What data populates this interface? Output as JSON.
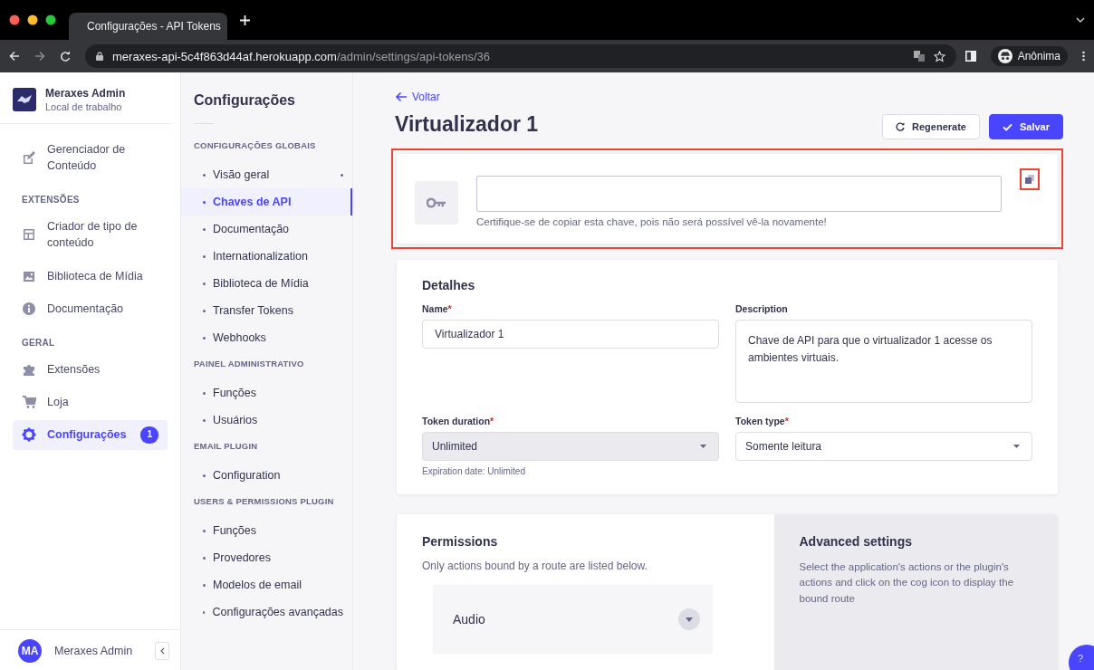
{
  "browser": {
    "tab_title": "Configurações - API Tokens",
    "url_host": "meraxes-api-5c4f863d44af.herokuapp.com",
    "url_path": "/admin/settings/api-tokens/36",
    "profile": "Anônima"
  },
  "sidebar": {
    "brand": {
      "title": "Meraxes Admin",
      "subtitle": "Local de trabalho"
    },
    "sections": [
      {
        "items": [
          {
            "label": "Gerenciador de Conteúdo",
            "selected": false
          }
        ]
      },
      {
        "heading": "EXTENSÕES",
        "items": [
          {
            "label": "Criador de tipo de conteúdo",
            "selected": false
          },
          {
            "label": "Biblioteca de Mídia",
            "selected": false
          },
          {
            "label": "Documentação",
            "selected": false
          }
        ]
      },
      {
        "heading": "GERAL",
        "items": [
          {
            "label": "Extensões",
            "selected": false
          },
          {
            "label": "Loja",
            "selected": false
          },
          {
            "label": "Configurações",
            "selected": true,
            "badge": "1"
          }
        ]
      }
    ],
    "user": {
      "initials": "MA",
      "name": "Meraxes Admin"
    }
  },
  "settings_nav": {
    "title": "Configurações",
    "sections": [
      {
        "heading": "CONFIGURAÇÕES GLOBAIS",
        "items": [
          {
            "label": "Visão geral",
            "selected": false,
            "marked": true
          },
          {
            "label": "Chaves de API",
            "selected": true,
            "marked": false
          },
          {
            "label": "Documentação",
            "selected": false,
            "marked": false
          },
          {
            "label": "Internationalization",
            "selected": false,
            "marked": false
          },
          {
            "label": "Biblioteca de Mídia",
            "selected": false,
            "marked": false
          },
          {
            "label": "Transfer Tokens",
            "selected": false,
            "marked": false
          },
          {
            "label": "Webhooks",
            "selected": false,
            "marked": false
          }
        ]
      },
      {
        "heading": "PAINEL ADMINISTRATIVO",
        "items": [
          {
            "label": "Funções",
            "selected": false,
            "marked": false
          },
          {
            "label": "Usuários",
            "selected": false,
            "marked": false
          }
        ]
      },
      {
        "heading": "EMAIL PLUGIN",
        "items": [
          {
            "label": "Configuration",
            "selected": false,
            "marked": false
          }
        ]
      },
      {
        "heading": "USERS & PERMISSIONS PLUGIN",
        "items": [
          {
            "label": "Funções",
            "selected": false,
            "marked": false
          },
          {
            "label": "Provedores",
            "selected": false,
            "marked": false
          },
          {
            "label": "Modelos de email",
            "selected": false,
            "marked": false
          },
          {
            "label": "Configurações avançadas",
            "selected": false,
            "marked": false
          }
        ]
      }
    ]
  },
  "header": {
    "back": "Voltar",
    "title": "Virtualizador 1",
    "buttons": [
      {
        "kind": "secondary",
        "label": "Regenerate"
      },
      {
        "kind": "primary",
        "label": "Salvar"
      }
    ]
  },
  "key_card": {
    "highlighted": true,
    "hint": "Certifique-se de copiar esta chave, pois não será possível vê-la novamente!",
    "copy_highlighted": true
  },
  "details": {
    "title": "Detalhes",
    "fields": [
      {
        "kind": "input",
        "label": "Name",
        "required_mark": "*",
        "value": "Virtualizador 1"
      },
      {
        "kind": "textarea",
        "label": "Description",
        "value": "Chave de API para que o virtualizador 1 acesse os ambientes virtuais."
      },
      {
        "kind": "select",
        "label": "Token duration",
        "required_mark": "*",
        "value": "Unlimited",
        "disabled": true,
        "hint": "Expiration date: Unlimited"
      },
      {
        "kind": "select",
        "label": "Token type",
        "required_mark": "*",
        "value": "Somente leitura",
        "disabled": false
      }
    ]
  },
  "permissions": {
    "title": "Permissions",
    "subtitle": "Only actions bound by a route are listed below.",
    "groups": [
      {
        "label": "Audio",
        "expanded": false
      }
    ],
    "advanced": {
      "title": "Advanced settings",
      "text": "Select the application's actions or the plugin's actions and click on the cog icon to display the bound route"
    }
  },
  "help": {
    "label": "?"
  }
}
